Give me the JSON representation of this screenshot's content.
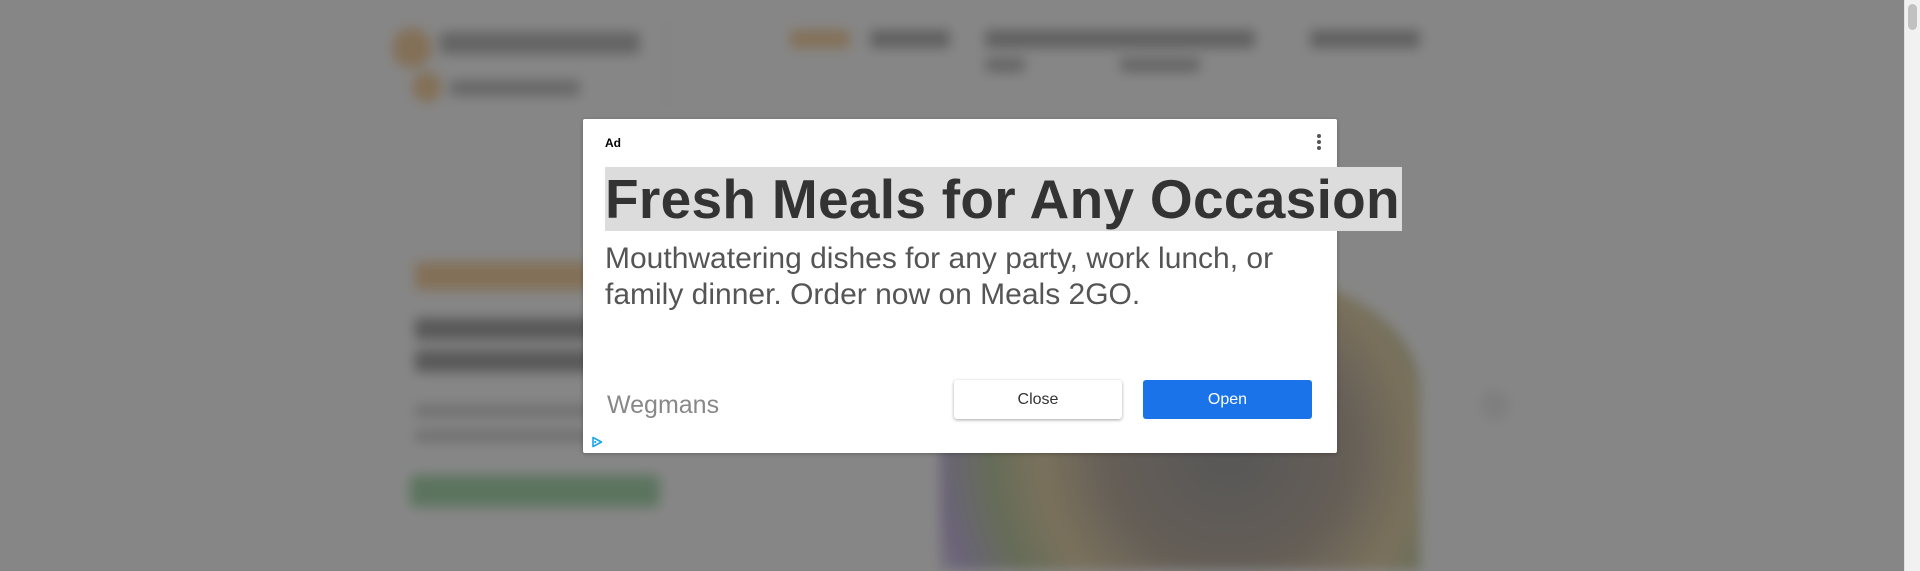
{
  "ad": {
    "label": "Ad",
    "headline": "Fresh Meals for Any Occasion",
    "body": "Mouthwatering dishes for any party, work lunch, or family dinner. Order now on Meals 2GO.",
    "advertiser": "Wegmans",
    "close_label": "Close",
    "open_label": "Open",
    "menu_icon": "more-vertical-icon",
    "adchoices_icon": "adchoices-icon"
  },
  "colors": {
    "open_button": "#1a73e8",
    "overlay": "#646464",
    "brand_orange": "#f19a2c",
    "hero_button": "#3fae4c"
  }
}
